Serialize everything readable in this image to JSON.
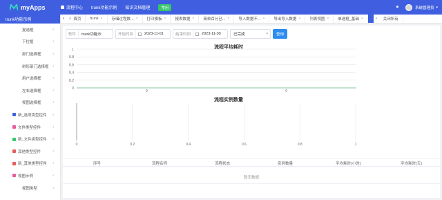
{
  "app": {
    "name": "myApps"
  },
  "top_menu": [
    {
      "label": "流程中心"
    },
    {
      "label": "trunk功能示例"
    },
    {
      "label": "知识文档管理"
    }
  ],
  "top_badge": "常用",
  "user": {
    "name": "系统管理员"
  },
  "sidebar": {
    "title": "trunk功能示例",
    "items": [
      {
        "label": "复选框",
        "icon": "",
        "color": ""
      },
      {
        "label": "下拉框",
        "icon": "",
        "color": ""
      },
      {
        "label": "部门选择框",
        "icon": "",
        "color": ""
      },
      {
        "label": "树形部门选择框",
        "icon": "",
        "color": ""
      },
      {
        "label": "用户选择框",
        "icon": "",
        "color": ""
      },
      {
        "label": "左右选择框",
        "icon": "",
        "color": ""
      },
      {
        "label": "视图选择框",
        "icon": "",
        "color": ""
      },
      {
        "label": "新_选项类型控件",
        "icon": "checkbox-icon",
        "color": "#3f5fe0"
      },
      {
        "label": "文件类型控件",
        "icon": "folder-icon",
        "color": "#e85a9b"
      },
      {
        "label": "新_文件类型控件",
        "icon": "folder-icon",
        "color": "#35c46a"
      },
      {
        "label": "其他类型控件",
        "icon": "grid-icon",
        "color": "#e85a5a"
      },
      {
        "label": "新_其他类型控件",
        "icon": "grid-icon",
        "color": "#e85a5a"
      },
      {
        "label": "视图示例",
        "icon": "eye-icon",
        "color": "#e85a9b"
      },
      {
        "label": "视图类型",
        "icon": "",
        "color": ""
      }
    ]
  },
  "tabs": {
    "home": "首页",
    "items": [
      "trunk",
      "存储过程数...",
      "打印模板",
      "报表数据",
      "简单百分已...",
      "导入数据不...",
      "导出导入数据",
      "列表视图",
      "单选框_基础"
    ],
    "close_all": "关闭所有"
  },
  "filter": {
    "software_label": "软件",
    "software_value": "trunk功能示",
    "start_label": "开始时间",
    "start_value": "2023-11-01",
    "end_label": "结束时间",
    "end_value": "2023-11-30",
    "status_value": "已完成",
    "search_label": "查询"
  },
  "table": {
    "headers": [
      "序号",
      "流程名称",
      "流程状态",
      "实例数量",
      "平均耗时(小时)",
      "平均耗时(天)"
    ],
    "empty_text": "暂无数据"
  },
  "chart_data": [
    {
      "type": "bar",
      "title": "流程平均耗时",
      "xlabel": "",
      "ylabel": "",
      "categories": [],
      "values": [],
      "ylim": [
        0,
        1
      ],
      "y_ticks": [
        "1",
        "0.8",
        "0.6",
        "0.4",
        "0.2",
        "0"
      ],
      "x_ticks": [
        "0",
        "0"
      ],
      "grid": true
    },
    {
      "type": "bar",
      "orientation": "horizontal",
      "title": "流程实例数量",
      "xlabel": "",
      "ylabel": "",
      "categories": [],
      "values": [],
      "xlim": [
        0,
        1
      ],
      "x_ticks": [
        "0",
        "0.2",
        "0.4",
        "0.6",
        "0.8",
        "1"
      ],
      "grid": true
    }
  ]
}
